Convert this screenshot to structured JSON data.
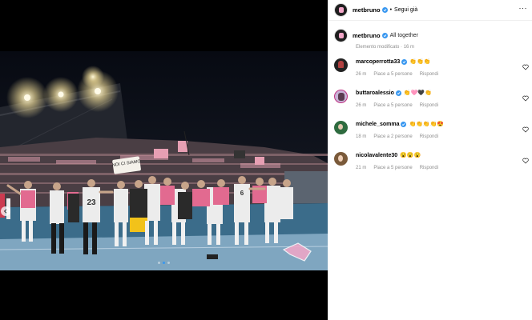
{
  "post": {
    "author": "metbruno",
    "follow_label": "Segui già",
    "separator": "•",
    "more_label": "···",
    "caption": "All together",
    "edited_label": "Elemento modificato · 16 m",
    "banner_text": "NOI CI SIAMO"
  },
  "comments": [
    {
      "user": "marcoperrotta33",
      "verified": true,
      "text": "👏👏👏",
      "time": "26 m",
      "likes": "Piace a 5 persone",
      "reply": "Rispondi"
    },
    {
      "user": "buttaroalessio",
      "verified": true,
      "text": "👏🩷🖤👏",
      "time": "26 m",
      "likes": "Piace a 5 persone",
      "reply": "Rispondi"
    },
    {
      "user": "michele_somma",
      "verified": true,
      "text": "👏👏👏👏😍",
      "time": "18 m",
      "likes": "Piace a 2 persone",
      "reply": "Rispondi"
    },
    {
      "user": "nicolavalente30",
      "verified": false,
      "text": "😮😮😮",
      "time": "21 m",
      "likes": "Piace a 5 persone",
      "reply": "Rispondi"
    }
  ],
  "carousel": {
    "slides": 3,
    "active": 2
  },
  "colors": {
    "accent": "#3897f0",
    "muted": "#8e8e8e",
    "pink": "#f3a6c8"
  }
}
